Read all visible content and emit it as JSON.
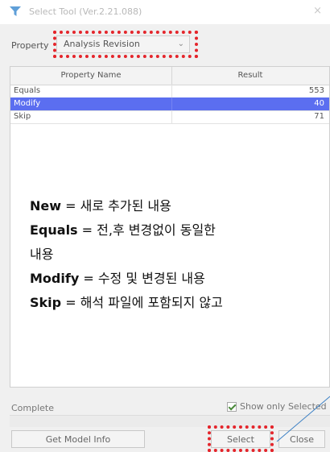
{
  "window": {
    "title": "Select Tool (Ver.2.21.088)",
    "close_glyph": "×"
  },
  "property": {
    "label": "Property",
    "selected": "Analysis Revision"
  },
  "grid": {
    "headers": [
      "Property Name",
      "Result"
    ],
    "rows": [
      {
        "name": "Equals",
        "result": "553",
        "selected": false
      },
      {
        "name": "Modify",
        "result": "40",
        "selected": true
      },
      {
        "name": "Skip",
        "result": "71",
        "selected": false
      }
    ]
  },
  "notes": [
    {
      "key": "New",
      "text": " = 새로 추가된 내용"
    },
    {
      "key": "Equals",
      "text": " = 전,후 변경없이 동일한"
    },
    {
      "key": "",
      "text": "내용"
    },
    {
      "key": "Modify",
      "text": " = 수정 및 변경된 내용"
    },
    {
      "key": "Skip",
      "text": " = 해석 파일에 포함되지 않고"
    }
  ],
  "footer": {
    "status": "Complete",
    "show_only_selected": "Show only Selected",
    "show_only_selected_checked": true,
    "get_model_info": "Get Model Info",
    "select": "Select",
    "close": "Close"
  },
  "colors": {
    "selection": "#5b6ef0",
    "highlight_border": "#e4252b",
    "callout_line": "#3a7fc4"
  },
  "icons": {
    "app": "funnel-icon",
    "dropdown": "chevron-down-icon"
  }
}
